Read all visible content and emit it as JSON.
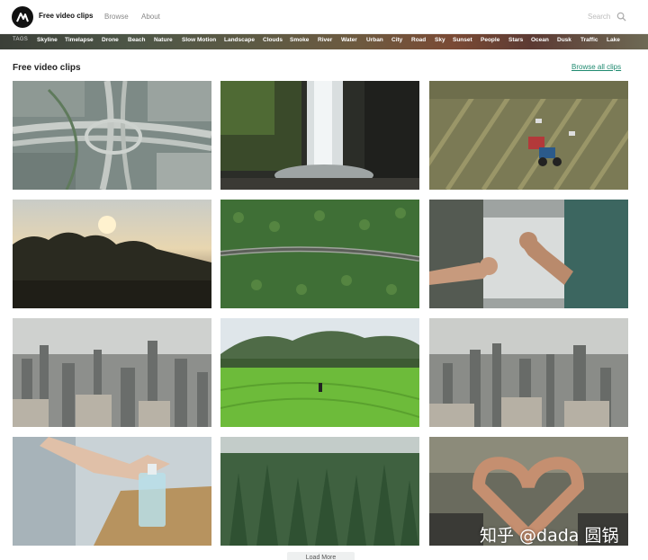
{
  "header": {
    "brand": "Free video clips",
    "nav": [
      "Browse",
      "About"
    ],
    "search_placeholder": "Search"
  },
  "tags": {
    "label": "TAGS",
    "items": [
      "Skyline",
      "Timelapse",
      "Drone",
      "Beach",
      "Nature",
      "Slow Motion",
      "Landscape",
      "Clouds",
      "Smoke",
      "River",
      "Water",
      "Urban",
      "City",
      "Road",
      "Sky",
      "Sunset",
      "People",
      "Stars",
      "Ocean",
      "Dusk",
      "Traffic",
      "Lake"
    ]
  },
  "section": {
    "title": "Free video clips",
    "browse_all": "Browse all clips"
  },
  "clips": [
    {
      "subject": "aerial highway interchange"
    },
    {
      "subject": "waterfall"
    },
    {
      "subject": "tractor in field"
    },
    {
      "subject": "sunset over forest"
    },
    {
      "subject": "road through forest aerial"
    },
    {
      "subject": "fist bump"
    },
    {
      "subject": "city skyline haze"
    },
    {
      "subject": "rice field valley"
    },
    {
      "subject": "city skyline buildings"
    },
    {
      "subject": "hand sanitizer"
    },
    {
      "subject": "pine forest"
    },
    {
      "subject": "heart hands"
    }
  ],
  "load_more": "Load More",
  "watermark": "知乎 @dada 圆锅"
}
